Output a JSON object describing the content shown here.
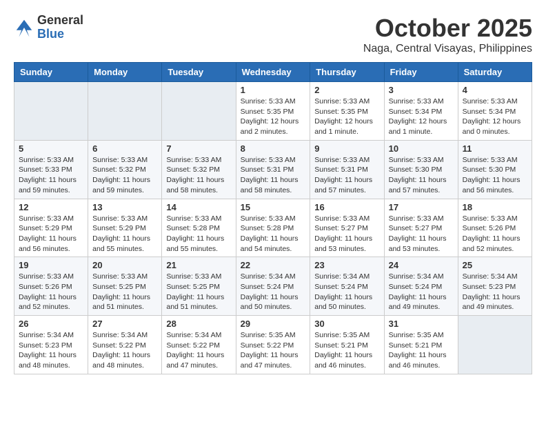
{
  "header": {
    "logo": {
      "general": "General",
      "blue": "Blue"
    },
    "title": "October 2025",
    "location": "Naga, Central Visayas, Philippines"
  },
  "days_of_week": [
    "Sunday",
    "Monday",
    "Tuesday",
    "Wednesday",
    "Thursday",
    "Friday",
    "Saturday"
  ],
  "weeks": [
    [
      {
        "day": "",
        "info": ""
      },
      {
        "day": "",
        "info": ""
      },
      {
        "day": "",
        "info": ""
      },
      {
        "day": "1",
        "info": "Sunrise: 5:33 AM\nSunset: 5:35 PM\nDaylight: 12 hours\nand 2 minutes."
      },
      {
        "day": "2",
        "info": "Sunrise: 5:33 AM\nSunset: 5:35 PM\nDaylight: 12 hours\nand 1 minute."
      },
      {
        "day": "3",
        "info": "Sunrise: 5:33 AM\nSunset: 5:34 PM\nDaylight: 12 hours\nand 1 minute."
      },
      {
        "day": "4",
        "info": "Sunrise: 5:33 AM\nSunset: 5:34 PM\nDaylight: 12 hours\nand 0 minutes."
      }
    ],
    [
      {
        "day": "5",
        "info": "Sunrise: 5:33 AM\nSunset: 5:33 PM\nDaylight: 11 hours\nand 59 minutes."
      },
      {
        "day": "6",
        "info": "Sunrise: 5:33 AM\nSunset: 5:32 PM\nDaylight: 11 hours\nand 59 minutes."
      },
      {
        "day": "7",
        "info": "Sunrise: 5:33 AM\nSunset: 5:32 PM\nDaylight: 11 hours\nand 58 minutes."
      },
      {
        "day": "8",
        "info": "Sunrise: 5:33 AM\nSunset: 5:31 PM\nDaylight: 11 hours\nand 58 minutes."
      },
      {
        "day": "9",
        "info": "Sunrise: 5:33 AM\nSunset: 5:31 PM\nDaylight: 11 hours\nand 57 minutes."
      },
      {
        "day": "10",
        "info": "Sunrise: 5:33 AM\nSunset: 5:30 PM\nDaylight: 11 hours\nand 57 minutes."
      },
      {
        "day": "11",
        "info": "Sunrise: 5:33 AM\nSunset: 5:30 PM\nDaylight: 11 hours\nand 56 minutes."
      }
    ],
    [
      {
        "day": "12",
        "info": "Sunrise: 5:33 AM\nSunset: 5:29 PM\nDaylight: 11 hours\nand 56 minutes."
      },
      {
        "day": "13",
        "info": "Sunrise: 5:33 AM\nSunset: 5:29 PM\nDaylight: 11 hours\nand 55 minutes."
      },
      {
        "day": "14",
        "info": "Sunrise: 5:33 AM\nSunset: 5:28 PM\nDaylight: 11 hours\nand 55 minutes."
      },
      {
        "day": "15",
        "info": "Sunrise: 5:33 AM\nSunset: 5:28 PM\nDaylight: 11 hours\nand 54 minutes."
      },
      {
        "day": "16",
        "info": "Sunrise: 5:33 AM\nSunset: 5:27 PM\nDaylight: 11 hours\nand 53 minutes."
      },
      {
        "day": "17",
        "info": "Sunrise: 5:33 AM\nSunset: 5:27 PM\nDaylight: 11 hours\nand 53 minutes."
      },
      {
        "day": "18",
        "info": "Sunrise: 5:33 AM\nSunset: 5:26 PM\nDaylight: 11 hours\nand 52 minutes."
      }
    ],
    [
      {
        "day": "19",
        "info": "Sunrise: 5:33 AM\nSunset: 5:26 PM\nDaylight: 11 hours\nand 52 minutes."
      },
      {
        "day": "20",
        "info": "Sunrise: 5:33 AM\nSunset: 5:25 PM\nDaylight: 11 hours\nand 51 minutes."
      },
      {
        "day": "21",
        "info": "Sunrise: 5:33 AM\nSunset: 5:25 PM\nDaylight: 11 hours\nand 51 minutes."
      },
      {
        "day": "22",
        "info": "Sunrise: 5:34 AM\nSunset: 5:24 PM\nDaylight: 11 hours\nand 50 minutes."
      },
      {
        "day": "23",
        "info": "Sunrise: 5:34 AM\nSunset: 5:24 PM\nDaylight: 11 hours\nand 50 minutes."
      },
      {
        "day": "24",
        "info": "Sunrise: 5:34 AM\nSunset: 5:24 PM\nDaylight: 11 hours\nand 49 minutes."
      },
      {
        "day": "25",
        "info": "Sunrise: 5:34 AM\nSunset: 5:23 PM\nDaylight: 11 hours\nand 49 minutes."
      }
    ],
    [
      {
        "day": "26",
        "info": "Sunrise: 5:34 AM\nSunset: 5:23 PM\nDaylight: 11 hours\nand 48 minutes."
      },
      {
        "day": "27",
        "info": "Sunrise: 5:34 AM\nSunset: 5:22 PM\nDaylight: 11 hours\nand 48 minutes."
      },
      {
        "day": "28",
        "info": "Sunrise: 5:34 AM\nSunset: 5:22 PM\nDaylight: 11 hours\nand 47 minutes."
      },
      {
        "day": "29",
        "info": "Sunrise: 5:35 AM\nSunset: 5:22 PM\nDaylight: 11 hours\nand 47 minutes."
      },
      {
        "day": "30",
        "info": "Sunrise: 5:35 AM\nSunset: 5:21 PM\nDaylight: 11 hours\nand 46 minutes."
      },
      {
        "day": "31",
        "info": "Sunrise: 5:35 AM\nSunset: 5:21 PM\nDaylight: 11 hours\nand 46 minutes."
      },
      {
        "day": "",
        "info": ""
      }
    ]
  ]
}
